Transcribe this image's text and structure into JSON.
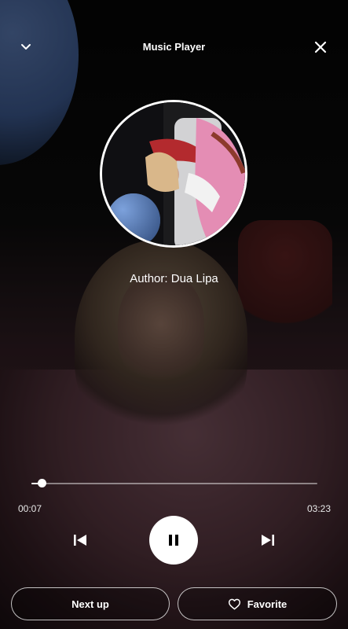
{
  "header": {
    "title": "Music Player",
    "collapse_icon": "chevron-down-icon",
    "close_icon": "close-icon"
  },
  "track": {
    "author": "Author: Dua Lipa"
  },
  "progress": {
    "elapsed": "00:07",
    "duration": "03:23",
    "fraction": 0.035
  },
  "controls": {
    "prev_icon": "skip-previous-icon",
    "play_pause_icon": "pause-icon",
    "next_icon": "skip-next-icon"
  },
  "actions": {
    "next_up_label": "Next up",
    "favorite_label": "Favorite",
    "favorite_icon": "heart-outline-icon"
  }
}
